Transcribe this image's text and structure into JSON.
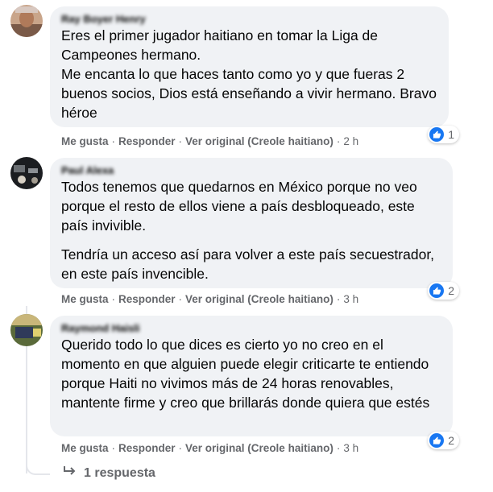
{
  "comments": [
    {
      "author": "Ray Boyer Henry",
      "paragraphs": [
        "Eres el primer jugador haitiano en tomar la Liga de Campeones hermano.\nMe encanta lo que haces tanto como yo y que fueras 2 buenos socios, Dios está enseñando a vivir hermano. Bravo héroe"
      ],
      "like": "Me gusta",
      "reply": "Responder",
      "original": "Ver original (Creole haitiano)",
      "time": "2 h",
      "reactions": "1"
    },
    {
      "author": "Paul Alexa",
      "paragraphs": [
        "Todos tenemos que quedarnos en México porque no veo porque el resto de ellos viene a país desbloqueado, este país invivible.",
        "Tendría un acceso así para volver a este país secuestrador, en este país invencible."
      ],
      "like": "Me gusta",
      "reply": "Responder",
      "original": "Ver original (Creole haitiano)",
      "time": "3 h",
      "reactions": "2"
    },
    {
      "author": "Raymond Haisli",
      "paragraphs": [
        "Querido todo lo que dices es cierto yo no creo en el momento en que alguien puede elegir criticarte te entiendo porque Haiti no vivimos más de 24 horas renovables, mantente firme y creo que brillarás donde quiera que estés"
      ],
      "like": "Me gusta",
      "reply": "Responder",
      "original": "Ver original (Creole haitiano)",
      "time": "3 h",
      "reactions": "2"
    }
  ],
  "replies_link": "1 respuesta",
  "colors": {
    "bubble": "#f0f2f5",
    "meta": "#65676b",
    "like_blue": "#1877f2"
  }
}
